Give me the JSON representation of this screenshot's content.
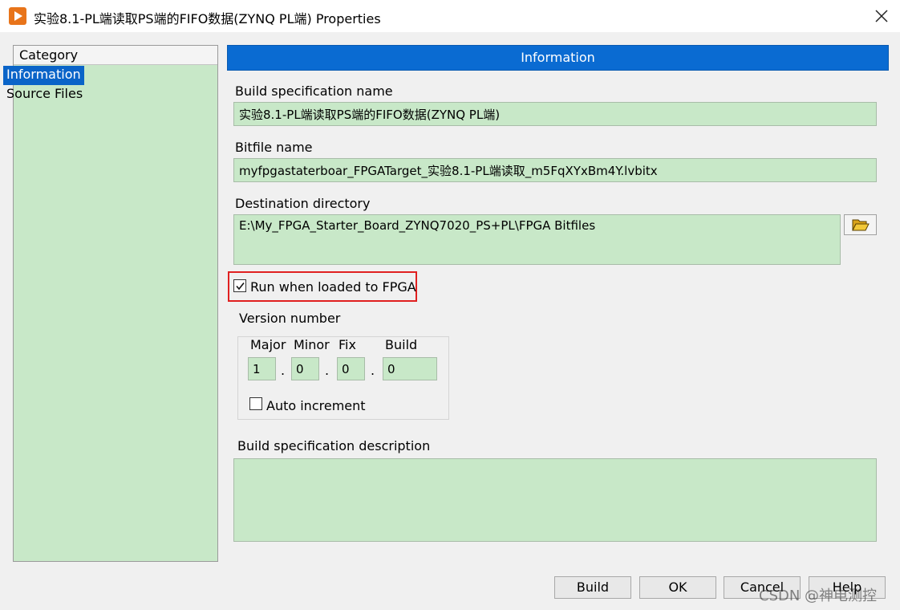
{
  "window": {
    "title": "实验8.1-PL端读取PS端的FIFO数据(ZYNQ PL端) Properties"
  },
  "sidebar": {
    "header": "Category",
    "items": [
      {
        "label": "Information",
        "selected": true
      },
      {
        "label": "Source Files",
        "selected": false
      }
    ]
  },
  "main": {
    "section_title": "Information",
    "build_spec_name": {
      "label": "Build specification name",
      "value": "实验8.1-PL端读取PS端的FIFO数据(ZYNQ PL端)"
    },
    "bitfile_name": {
      "label": "Bitfile name",
      "value": "myfpgastaterboar_FPGATarget_实验8.1-PL端读取_m5FqXYxBm4Y.lvbitx"
    },
    "destination_directory": {
      "label": "Destination directory",
      "value": "E:\\My_FPGA_Starter_Board_ZYNQ7020_PS+PL\\FPGA Bitfiles",
      "browse_icon": "folder-open-icon"
    },
    "run_when_loaded": {
      "label": "Run when loaded to FPGA",
      "checked": true
    },
    "version": {
      "label": "Version number",
      "major_label": "Major",
      "minor_label": "Minor",
      "fix_label": "Fix",
      "build_label": "Build",
      "major": "1",
      "minor": "0",
      "fix": "0",
      "build": "0",
      "separator": ".",
      "auto_increment_label": "Auto increment",
      "auto_increment_checked": false
    },
    "description": {
      "label": "Build specification description",
      "value": ""
    }
  },
  "footer": {
    "build_label": "Build",
    "ok_label": "OK",
    "cancel_label": "Cancel",
    "help_label": "Help"
  },
  "watermark": "CSDN @神电测控",
  "colors": {
    "field_bg": "#c8e8c8",
    "header_blue": "#0a6bd2",
    "highlight_red": "#e02020",
    "app_icon_orange": "#e8741a"
  }
}
